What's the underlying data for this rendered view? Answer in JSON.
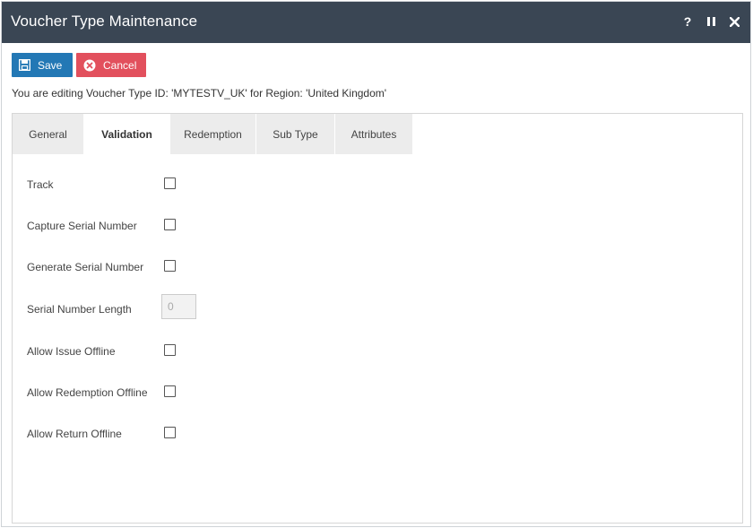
{
  "window": {
    "title": "Voucher Type Maintenance",
    "help_label": "?",
    "pause_label": "II",
    "close_label": "✕"
  },
  "toolbar": {
    "save_label": "Save",
    "cancel_label": "Cancel"
  },
  "editing_message": "You are editing Voucher Type ID: 'MYTESTV_UK' for Region: 'United Kingdom'",
  "tabs": [
    {
      "label": "General",
      "active": false
    },
    {
      "label": "Validation",
      "active": true
    },
    {
      "label": "Redemption",
      "active": false
    },
    {
      "label": "Sub Type",
      "active": false
    },
    {
      "label": "Attributes",
      "active": false
    }
  ],
  "form": {
    "track": {
      "label": "Track",
      "checked": false
    },
    "capture_serial": {
      "label": "Capture Serial Number",
      "checked": false
    },
    "generate_serial": {
      "label": "Generate Serial Number",
      "checked": false
    },
    "serial_length": {
      "label": "Serial Number Length",
      "value": "0"
    },
    "allow_issue_offline": {
      "label": "Allow Issue Offline",
      "checked": false
    },
    "allow_redemption_offline": {
      "label": "Allow Redemption Offline",
      "checked": false
    },
    "allow_return_offline": {
      "label": "Allow Return Offline",
      "checked": false
    }
  },
  "colors": {
    "titlebar": "#3a4654",
    "save_button": "#2378b5",
    "cancel_button": "#e2505d",
    "tab_inactive": "#ececec"
  },
  "icons": {
    "save": "floppy-disk-icon",
    "cancel": "x-circle-icon",
    "help": "question-icon",
    "pause": "pause-icon",
    "close": "close-icon"
  }
}
